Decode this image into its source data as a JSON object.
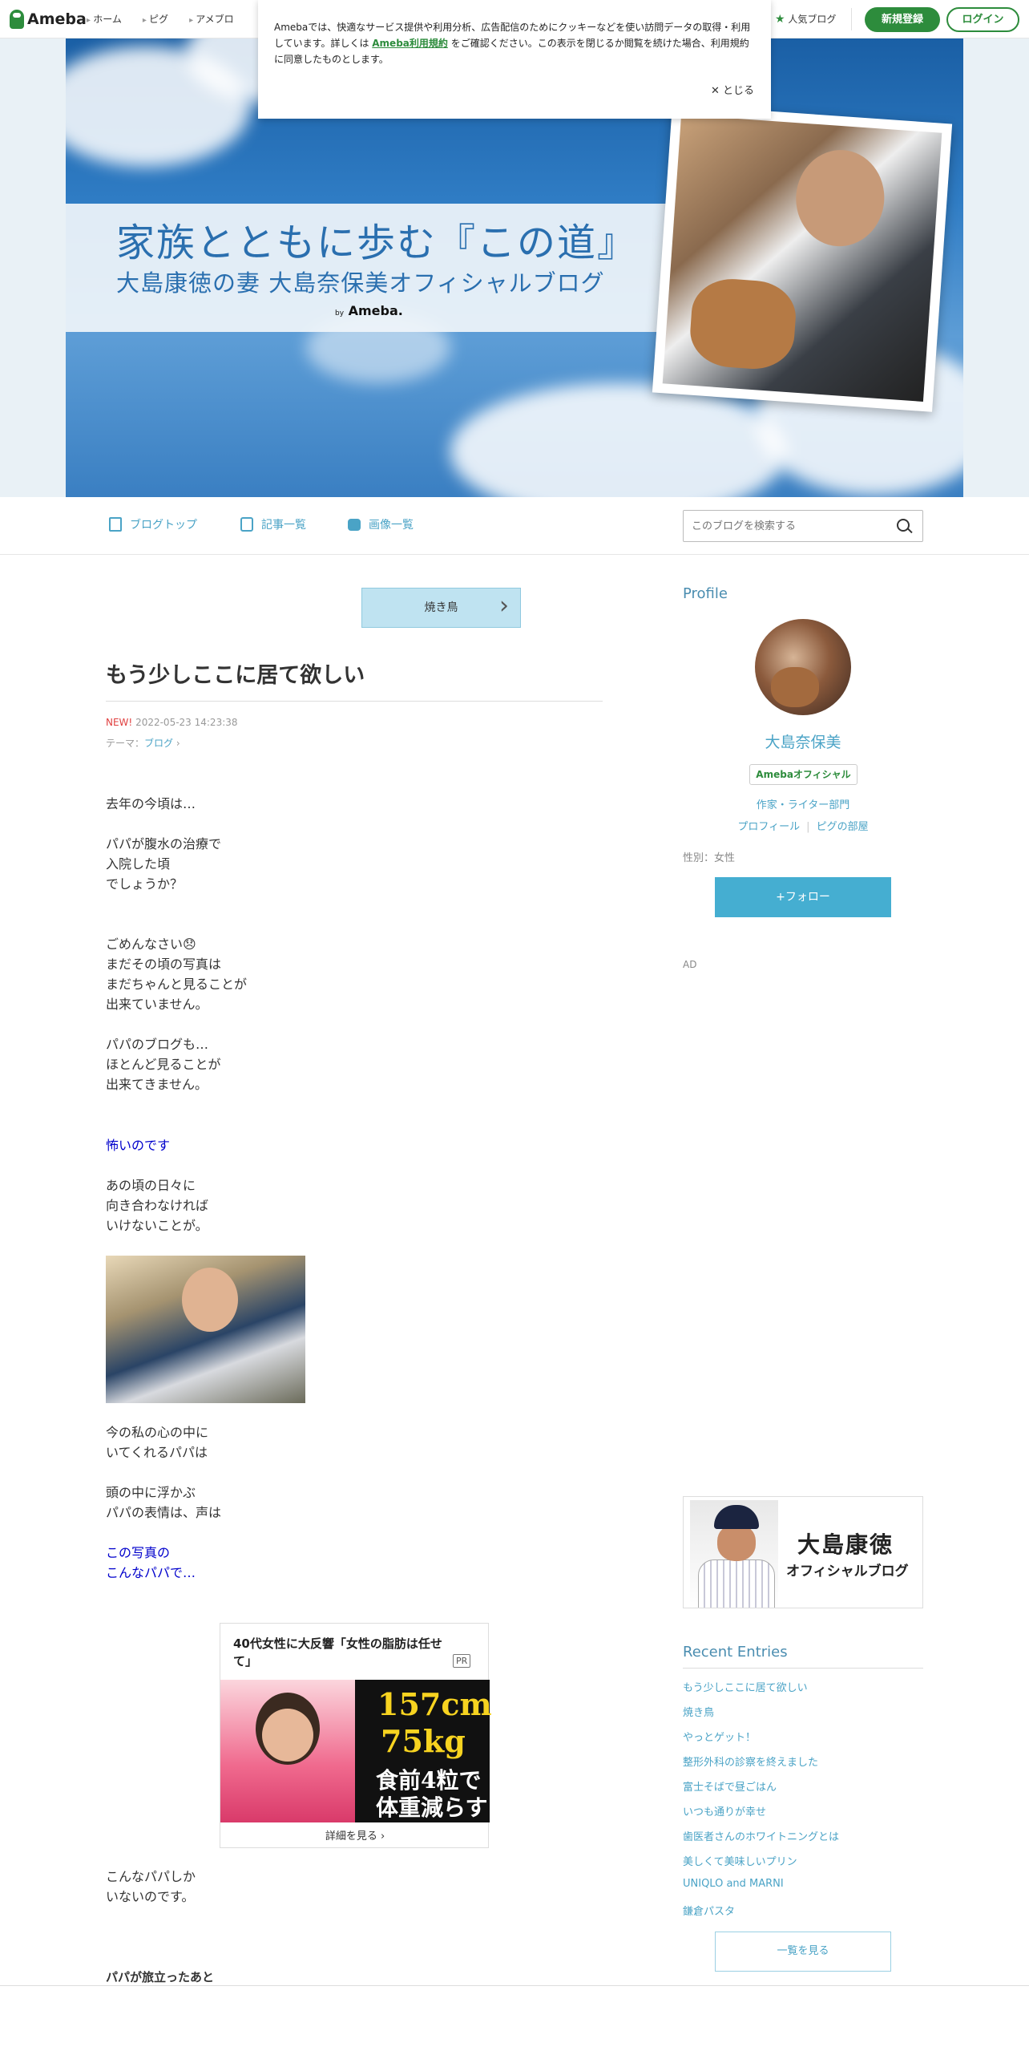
{
  "topbar": {
    "logo": "Ameba",
    "nav": [
      "ホーム",
      "ピグ",
      "アメブロ"
    ],
    "popular": "人気ブログ",
    "signup": "新規登録",
    "login": "ログイン"
  },
  "cookie": {
    "text_before": "Amebaでは、快適なサービス提供や利用分析、広告配信のためにクッキーなどを使い訪問データの取得・利用しています。詳しくは ",
    "link": "Ameba利用規約",
    "text_after": " をご確認ください。この表示を閉じるか閲覧を続けた場合、利用規約に同意したものとします。",
    "close": "✕ とじる"
  },
  "hero": {
    "title": "家族とともに歩む『この道』",
    "subtitle": "大島康徳の妻 大島奈保美オフィシャルブログ",
    "by": "by",
    "brand": "Ameba."
  },
  "blognav": {
    "top": "ブログトップ",
    "entries": "記事一覧",
    "images": "画像一覧",
    "search_placeholder": "このブログを検索する"
  },
  "post": {
    "prev_button": "焼き鳥",
    "title": "もう少しここに居て欲しい",
    "new_label": "NEW!",
    "datetime": "2022-05-23 14:23:38",
    "theme_label": "テーマ：",
    "theme": "ブログ",
    "p1": "去年の今頃は…\n\nパパが腹水の治療で\n入院した頃\nでしょうか？",
    "p2": "ごめんなさい😞\nまだその頃の写真は\nまだちゃんと見ることが\n出来ていません。\n\nパパのブログも…\nほとんど見ることが\n出来てきません。",
    "p3": "怖いのです",
    "p4": "あの頃の日々に\n向き合わなければ\nいけないことが。",
    "p5": "今の私の心の中に\nいてくれるパパは\n\n頭の中に浮かぶ\nパパの表情は、声は",
    "p6": "この写真の\nこんなパパで…",
    "p7": "こんなパパしか\nいないのです。",
    "p8": "パパが旅立ったあと"
  },
  "ad": {
    "title": "40代女性に大反響「女性の脂肪は任せて」",
    "pr": "PR",
    "img_line1": "157cm",
    "img_line2": "75kg",
    "img_line3": "食前4粒で",
    "img_line4": "体重減らす",
    "more": "詳細を見る ›"
  },
  "sidebar": {
    "profile_heading": "Profile",
    "name": "大島奈保美",
    "badge": "Amebaオフィシャル",
    "category": "作家・ライター部門",
    "link_profile": "プロフィール",
    "link_pig": "ピグの部屋",
    "gender": "性別：女性",
    "follow": "+フォロー",
    "ad_label": "AD",
    "banner_name": "大島康徳",
    "banner_sub": "オフィシャルブログ",
    "recent_heading": "Recent Entries",
    "recent": [
      "もう少しここに居て欲しい",
      "焼き鳥",
      "やっとゲット！",
      "整形外科の診察を終えました",
      "富士そばで昼ごはん",
      "いつも通りが幸せ",
      "歯医者さんのホワイトニングとは",
      "美しくて美味しいプリン",
      "UNIQLO and MARNI",
      "鎌倉パスタ"
    ],
    "more_entries": "一覧を見る"
  }
}
